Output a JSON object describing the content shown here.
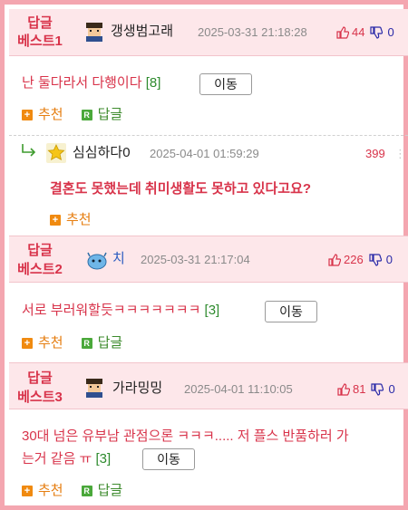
{
  "items": [
    {
      "best_line1": "답글",
      "best_line2": "베스트1",
      "nickname": "갱생범고래",
      "time": "2025-03-31 21:18:28",
      "up": "44",
      "down": "0",
      "text": "난 둘다라서 다행이다",
      "reply_count": "[8]",
      "move_label": "이동",
      "recommend_label": "추천",
      "reply_label": "답글",
      "avatar_icon": "pixel-man-icon"
    },
    {
      "best_line1": "답글",
      "best_line2": "베스트2",
      "nickname": "치",
      "time": "2025-03-31 21:17:04",
      "up": "226",
      "down": "0",
      "text": "서로 부러워할듯ㅋㅋㅋㅋㅋㅋㅋ",
      "reply_count": "[3]",
      "move_label": "이동",
      "recommend_label": "추천",
      "reply_label": "답글",
      "avatar_icon": "blue-blob-icon"
    },
    {
      "best_line1": "답글",
      "best_line2": "베스트3",
      "nickname": "가라밍밍",
      "time": "2025-04-01 11:10:05",
      "up": "81",
      "down": "0",
      "text_line1": "30대 넘은 유부남 관점으론 ㅋㅋㅋ..... 저 플스 반품하러 가",
      "text_line2": "는거 같음 ㅠ",
      "reply_count": "[3]",
      "move_label": "이동",
      "recommend_label": "추천",
      "reply_label": "답글",
      "avatar_icon": "pixel-man-icon"
    }
  ],
  "sub_reply": {
    "nickname": "심심하다0",
    "time": "2025-04-01 01:59:29",
    "score": "399",
    "text": "결혼도 못했는데 취미생활도 못하고 있다고요?",
    "recommend_label": "추천",
    "reply_arrow_icon": "reply-arrow-icon",
    "badge_icon": "yellow-star-icon"
  },
  "colors": {
    "accent": "#d8334a",
    "frame": "#f4a6b0",
    "header_bg": "#fde7ea",
    "down_vote": "#2a2aa8",
    "count": "#2e8b2e"
  }
}
